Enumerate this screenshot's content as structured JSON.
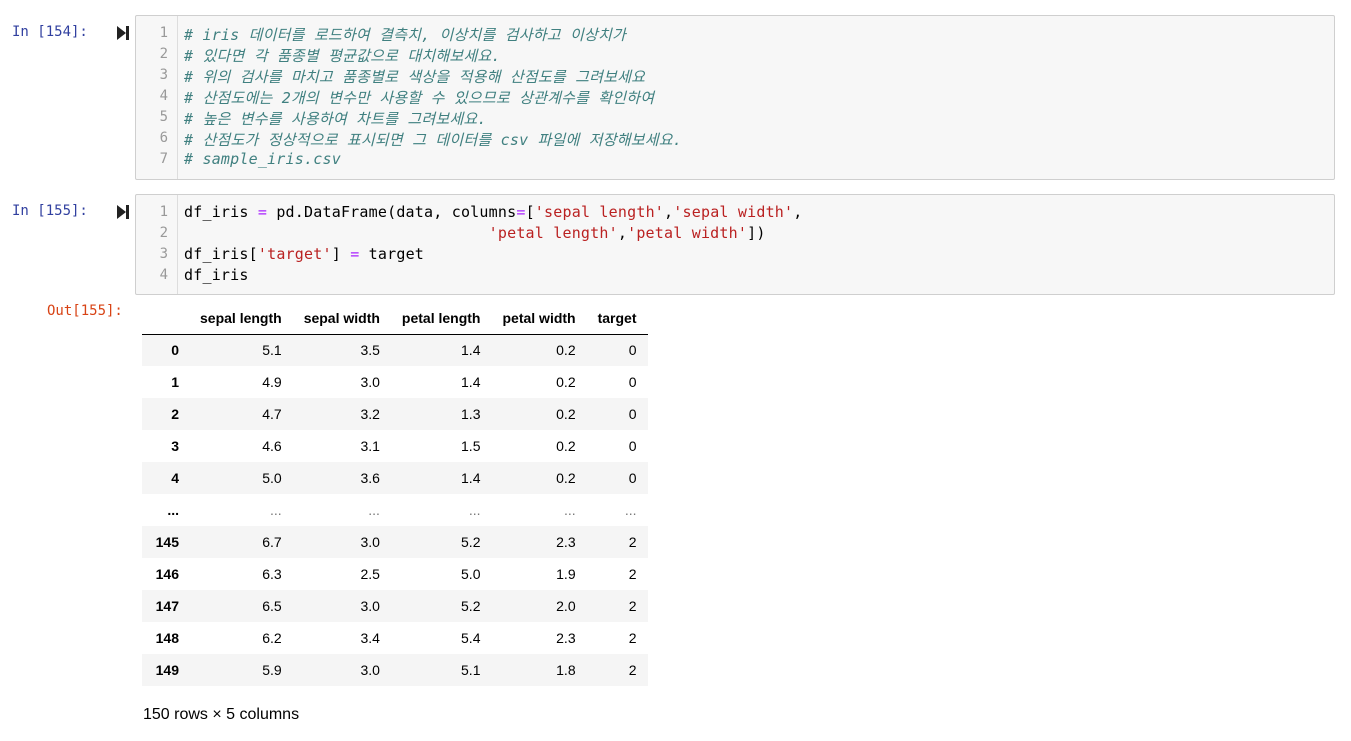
{
  "cells": [
    {
      "prompt": "In [154]:",
      "line_numbers": [
        "1",
        "2",
        "3",
        "4",
        "5",
        "6",
        "7"
      ],
      "lines": [
        "# iris 데이터를 로드하여 결측치, 이상치를 검사하고 이상치가",
        "# 있다면 각 품종별 평균값으로 대치해보세요.",
        "# 위의 검사를 마치고 품종별로 색상을 적용해 산점도를 그려보세요",
        "# 산점도에는 2개의 변수만 사용할 수 있으므로 상관계수를 확인하여",
        "# 높은 변수를 사용하여 차트를 그려보세요.",
        "# 산점도가 정상적으로 표시되면 그 데이터를 csv 파일에 저장해보세요.",
        "# sample_iris.csv"
      ]
    },
    {
      "prompt": "In [155]:",
      "out_prompt": "Out[155]:",
      "line_numbers": [
        "1",
        "2",
        "3",
        "4"
      ],
      "line1": {
        "a": "df_iris ",
        "eq": "=",
        "b": " pd.DataFrame(data, columns",
        "eq2": "=",
        "c": "[",
        "s1": "'sepal length'",
        "d": ",",
        "s2": "'sepal width'",
        "e": ","
      },
      "line2": {
        "indent": "                                 ",
        "s1": "'petal length'",
        "d": ",",
        "s2": "'petal width'",
        "e": "])"
      },
      "line3": {
        "a": "df_iris[",
        "s1": "'target'",
        "b": "] ",
        "eq": "=",
        "c": " target"
      },
      "line4": "df_iris"
    }
  ],
  "dataframe": {
    "columns": [
      "sepal length",
      "sepal width",
      "petal length",
      "petal width",
      "target"
    ],
    "rows": [
      {
        "index": "0",
        "values": [
          "5.1",
          "3.5",
          "1.4",
          "0.2",
          "0"
        ]
      },
      {
        "index": "1",
        "values": [
          "4.9",
          "3.0",
          "1.4",
          "0.2",
          "0"
        ]
      },
      {
        "index": "2",
        "values": [
          "4.7",
          "3.2",
          "1.3",
          "0.2",
          "0"
        ]
      },
      {
        "index": "3",
        "values": [
          "4.6",
          "3.1",
          "1.5",
          "0.2",
          "0"
        ]
      },
      {
        "index": "4",
        "values": [
          "5.0",
          "3.6",
          "1.4",
          "0.2",
          "0"
        ]
      },
      {
        "index": "...",
        "values": [
          "...",
          "...",
          "...",
          "...",
          "..."
        ]
      },
      {
        "index": "145",
        "values": [
          "6.7",
          "3.0",
          "5.2",
          "2.3",
          "2"
        ]
      },
      {
        "index": "146",
        "values": [
          "6.3",
          "2.5",
          "5.0",
          "1.9",
          "2"
        ]
      },
      {
        "index": "147",
        "values": [
          "6.5",
          "3.0",
          "5.2",
          "2.0",
          "2"
        ]
      },
      {
        "index": "148",
        "values": [
          "6.2",
          "3.4",
          "5.4",
          "2.3",
          "2"
        ]
      },
      {
        "index": "149",
        "values": [
          "5.9",
          "3.0",
          "5.1",
          "1.8",
          "2"
        ]
      }
    ],
    "shape_text": "150 rows × 5 columns"
  },
  "icons": {
    "run": "run-cell-icon"
  }
}
